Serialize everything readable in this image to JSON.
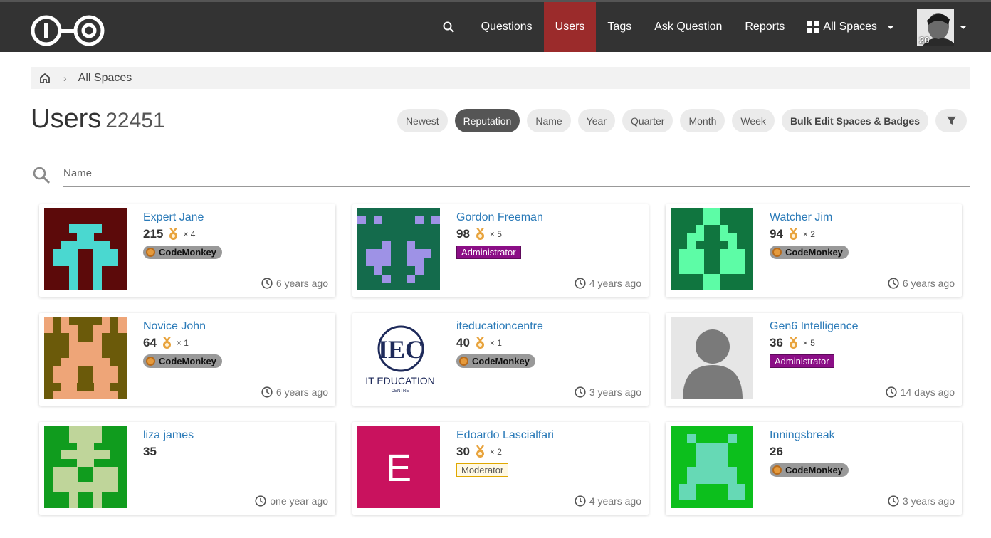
{
  "nav": {
    "items": [
      {
        "label": "Questions",
        "active": false
      },
      {
        "label": "Users",
        "active": true
      },
      {
        "label": "Tags",
        "active": false
      },
      {
        "label": "Ask Question",
        "active": false
      },
      {
        "label": "Reports",
        "active": false
      }
    ],
    "spaces_label": "All Spaces",
    "avatar_count": "20"
  },
  "breadcrumb": {
    "items": [
      "All Spaces"
    ]
  },
  "page": {
    "title": "Users",
    "count": "22451"
  },
  "sort": {
    "options": [
      "Newest",
      "Reputation",
      "Name",
      "Year",
      "Quarter",
      "Month",
      "Week"
    ],
    "active": "Reputation",
    "bulk_label": "Bulk Edit Spaces & Badges"
  },
  "search": {
    "placeholder": "Name",
    "value": ""
  },
  "users": [
    {
      "name": "Expert Jane",
      "reputation": "215",
      "badge_count": "× 4",
      "role": "CodeMonkey",
      "role_type": "monkey",
      "time": "6 years ago",
      "avatar": "jane"
    },
    {
      "name": "Gordon Freeman",
      "reputation": "98",
      "badge_count": "× 5",
      "role": "Administrator",
      "role_type": "admin",
      "time": "4 years ago",
      "avatar": "gordon"
    },
    {
      "name": "Watcher Jim",
      "reputation": "94",
      "badge_count": "× 2",
      "role": "CodeMonkey",
      "role_type": "monkey",
      "time": "6 years ago",
      "avatar": "jim"
    },
    {
      "name": "Novice John",
      "reputation": "64",
      "badge_count": "× 1",
      "role": "CodeMonkey",
      "role_type": "monkey",
      "time": "6 years ago",
      "avatar": "john"
    },
    {
      "name": "iteducationcentre",
      "reputation": "40",
      "badge_count": "× 1",
      "role": "CodeMonkey",
      "role_type": "monkey",
      "time": "3 years ago",
      "avatar": "itec",
      "logo_text": "IT EDUCATION",
      "logo_sub": "CENTRE",
      "logo_letters": "IEC"
    },
    {
      "name": "Gen6 Intelligence",
      "reputation": "36",
      "badge_count": "× 5",
      "role": "Administrator",
      "role_type": "admin",
      "time": "14 days ago",
      "avatar": "generic"
    },
    {
      "name": "liza james",
      "reputation": "35",
      "badge_count": "",
      "role": "",
      "role_type": "",
      "time": "one year ago",
      "avatar": "liza"
    },
    {
      "name": "Edoardo Lascialfari",
      "reputation": "30",
      "badge_count": "× 2",
      "role": "Moderator",
      "role_type": "mod",
      "time": "4 years ago",
      "avatar": "letter",
      "avatar_letter": "E"
    },
    {
      "name": "Inningsbreak",
      "reputation": "26",
      "badge_count": "",
      "role": "CodeMonkey",
      "role_type": "monkey",
      "time": "3 years ago",
      "avatar": "innings"
    }
  ],
  "colors": {
    "navbar": "#333333",
    "active_nav": "#9b2b2b",
    "link": "#2a7ab8",
    "admin_badge": "#8b0e86",
    "medal": "#e8a33d"
  }
}
